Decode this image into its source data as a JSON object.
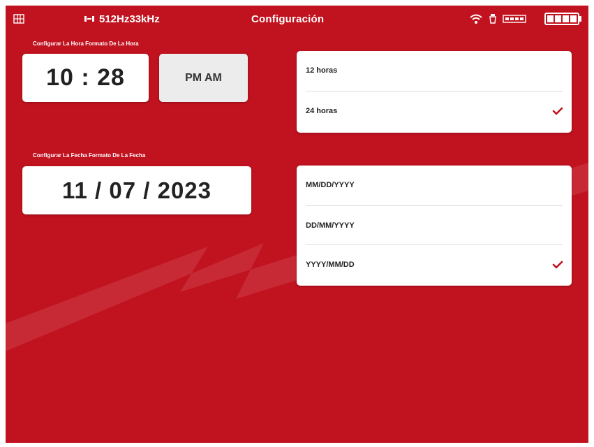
{
  "status_bar": {
    "frequency": "512Hz33kHz",
    "title": "Configuración",
    "icons": [
      "grid-icon",
      "signal-icon",
      "wifi-icon",
      "lamp-icon",
      "battery-small-icon",
      "battery-icon"
    ]
  },
  "time_section": {
    "label": "Configurar La Hora Formato De La Hora",
    "time": "10 : 28",
    "ampm": "PM AM",
    "options": [
      {
        "label": "12 horas",
        "selected": false
      },
      {
        "label": "24 horas",
        "selected": true
      }
    ]
  },
  "date_section": {
    "label": "Configurar La Fecha Formato De La Fecha",
    "date": "11 / 07 / 2023",
    "options": [
      {
        "label": "MM/DD/YYYY",
        "selected": false
      },
      {
        "label": "DD/MM/YYYY",
        "selected": false
      },
      {
        "label": "YYYY/MM/DD",
        "selected": true
      }
    ]
  },
  "colors": {
    "background": "#c1121f",
    "card": "#ffffff",
    "check": "#c1121f"
  }
}
